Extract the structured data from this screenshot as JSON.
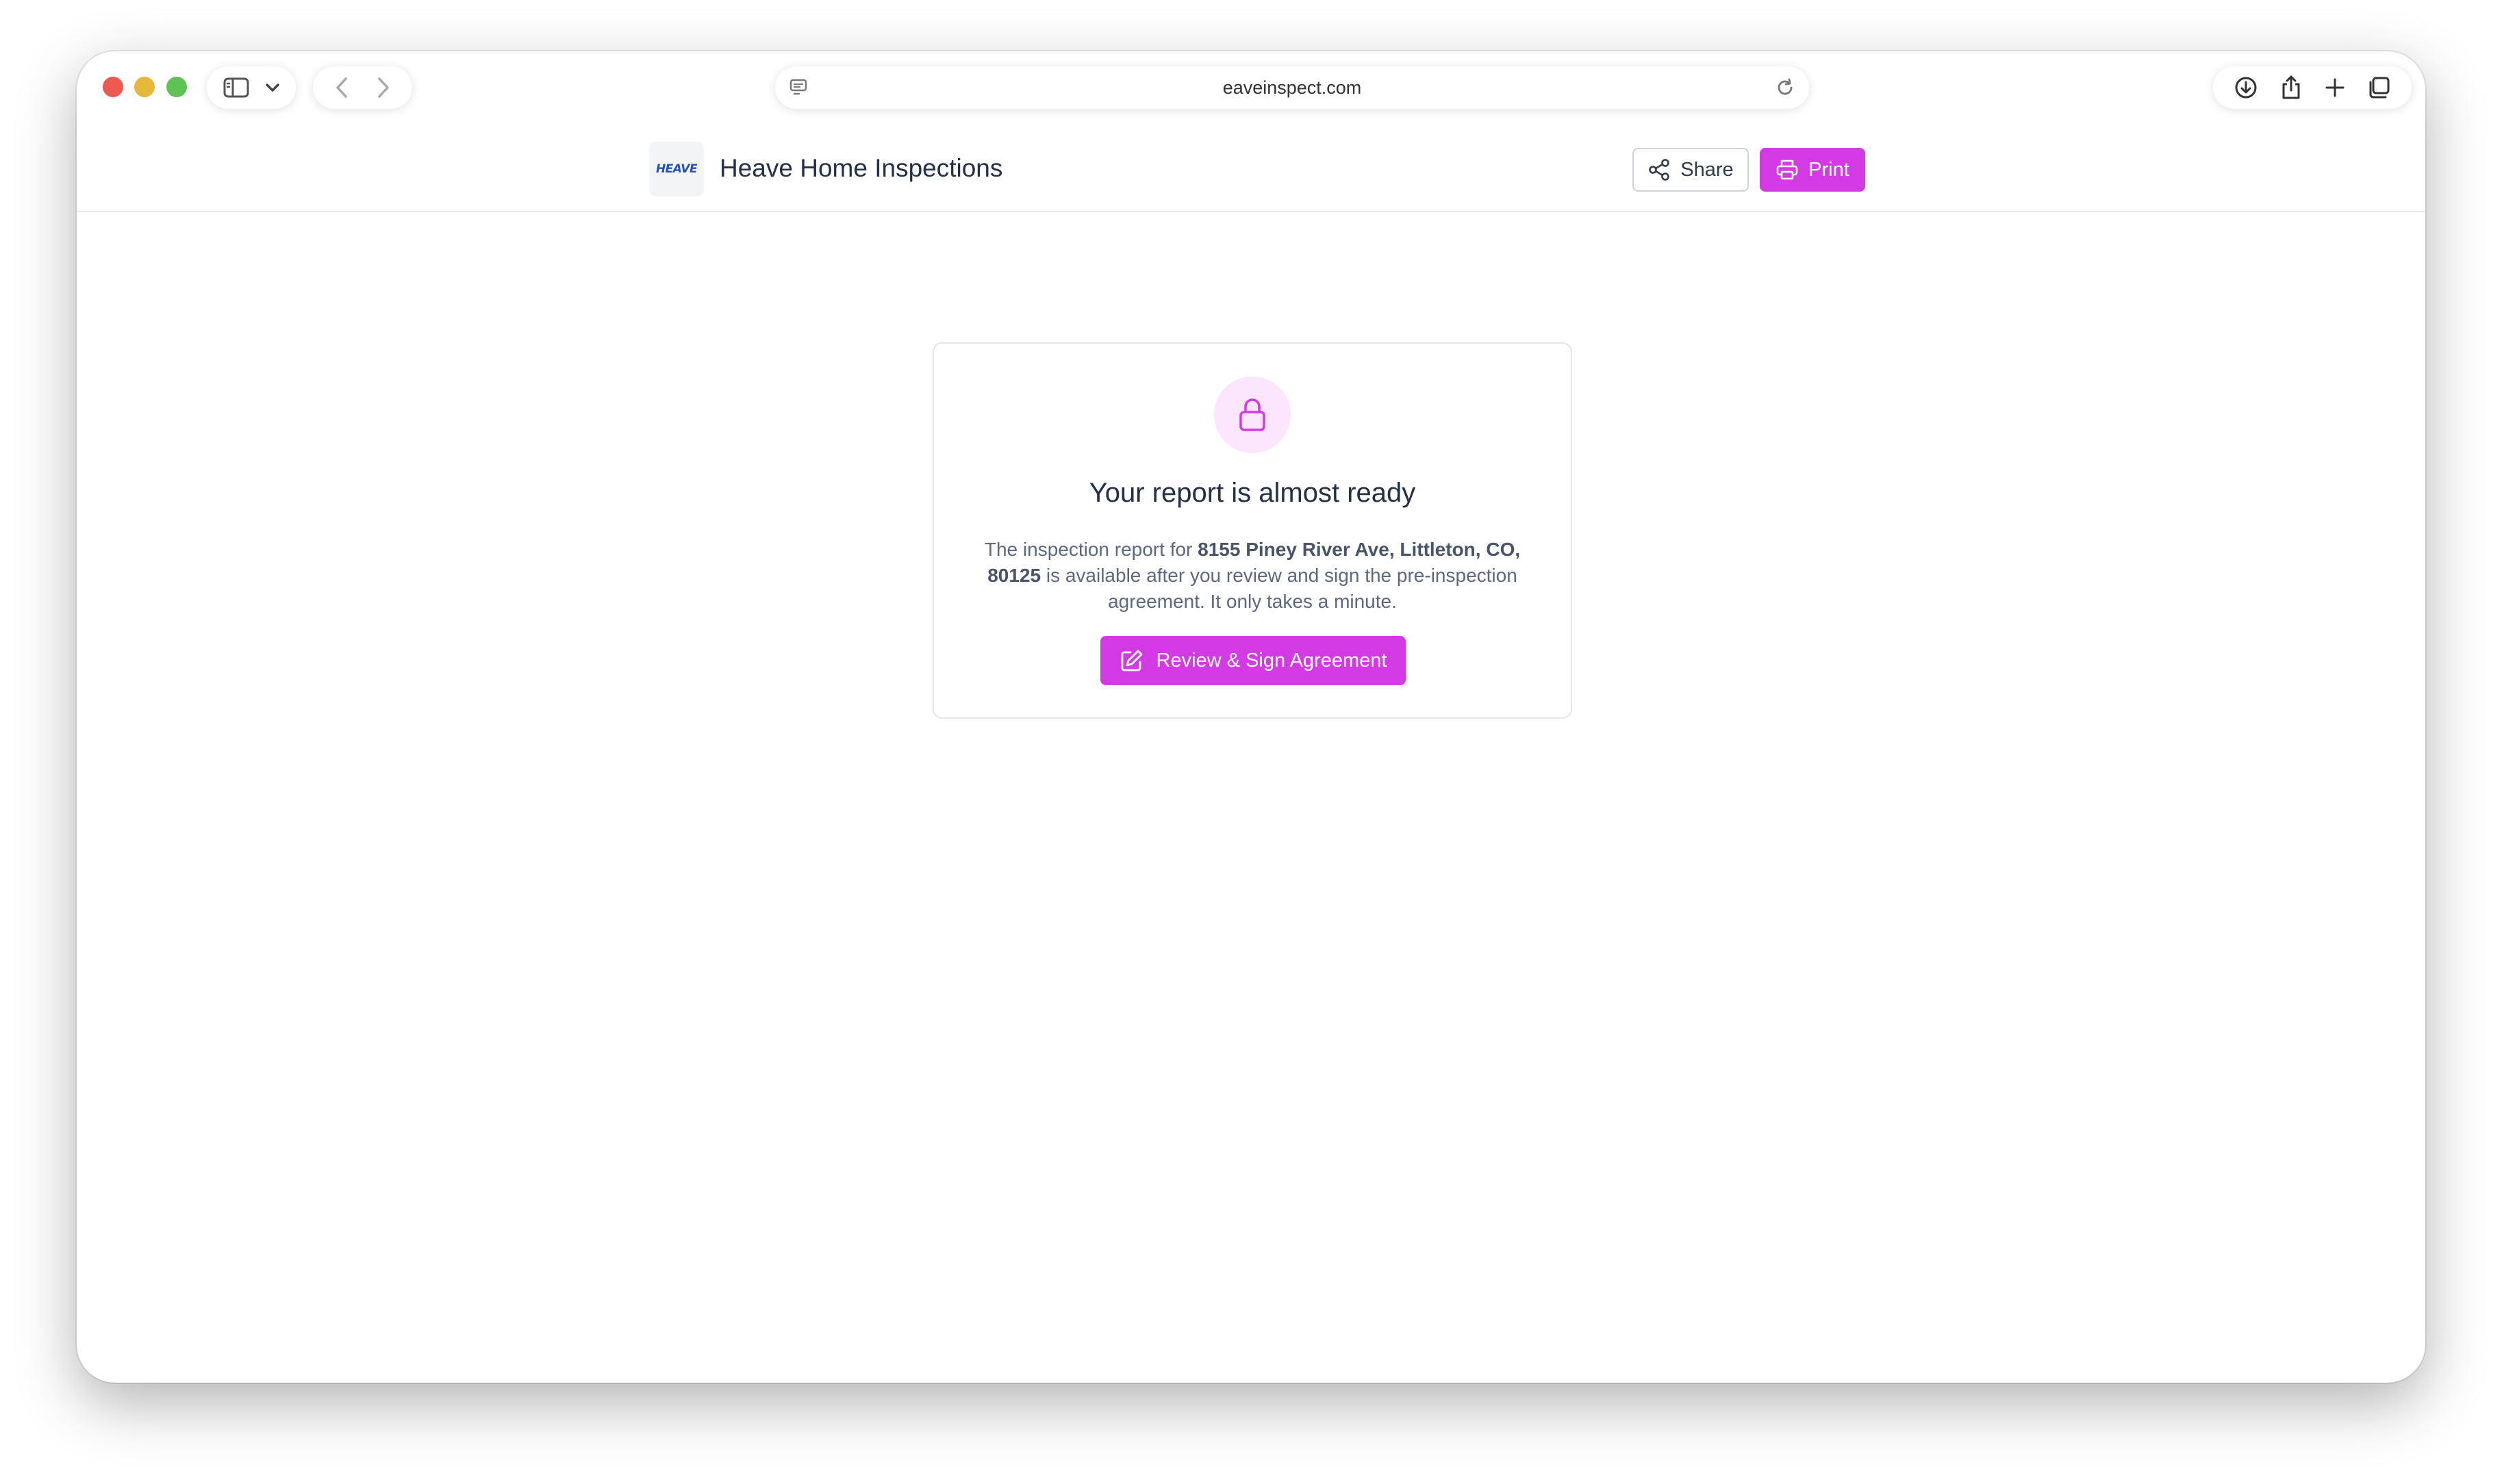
{
  "browser": {
    "url": "eaveinspect.com",
    "icons": {
      "sidebar": "sidebar-icon",
      "chevron": "chevron-down-icon",
      "back": "back-arrow-icon",
      "forward": "forward-arrow-icon",
      "site_settings": "page-settings-icon",
      "reload": "reload-icon",
      "download": "download-icon",
      "share": "share-icon",
      "new_tab": "plus-icon",
      "tabs": "tab-overview-icon"
    }
  },
  "header": {
    "logo_text": "HEAVE",
    "title": "Heave Home Inspections",
    "share_label": "Share",
    "print_label": "Print"
  },
  "card": {
    "title": "Your report is almost ready",
    "body_prefix": "The inspection report for ",
    "address": "8155 Piney River Ave, Littleton, CO, 80125",
    "body_suffix": " is available after you review and sign the pre-inspection agreement. It only takes a minute.",
    "cta_label": "Review & Sign Agreement"
  },
  "colors": {
    "accent": "#d43ae3",
    "accent_light": "#fbe6fd",
    "text_primary": "#243045",
    "text_secondary": "#5c6780",
    "logo": "#2750b6"
  }
}
